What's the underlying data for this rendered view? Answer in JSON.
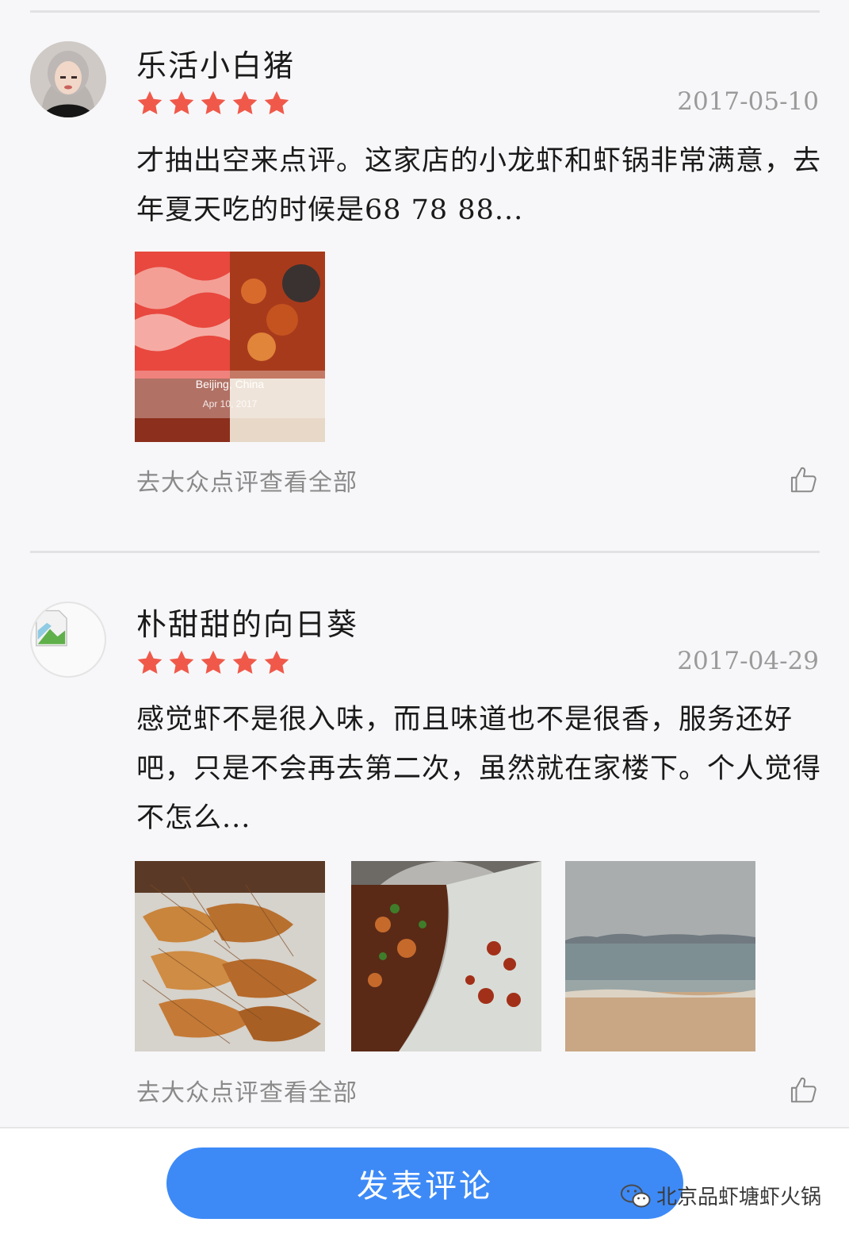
{
  "reviews": [
    {
      "username": "乐活小白猪",
      "rating": 5,
      "date": "2017-05-10",
      "text": "才抽出空来点评。这家店的小龙虾和虾锅非常满意，去年夏天吃的时候是68 78 88...",
      "photos": [
        {
          "name": "collage-photo",
          "overlay_place": "Beijing, China",
          "overlay_date": "Apr 10, 2017"
        }
      ],
      "more_link": "去大众点评查看全部"
    },
    {
      "username": "朴甜甜的向日葵",
      "rating": 5,
      "date": "2017-04-29",
      "text": "感觉虾不是很入味，而且味道也不是很香，服务还好吧，只是不会再去第二次，虽然就在家楼下。个人觉得不怎么...",
      "photos": [
        {
          "name": "fried-shrimp-photo"
        },
        {
          "name": "hotpot-photo"
        },
        {
          "name": "beach-photo"
        }
      ],
      "more_link": "去大众点评查看全部"
    }
  ],
  "bottom_bar": {
    "post_button": "发表评论",
    "watermark": "北京品虾塘虾火锅"
  },
  "colors": {
    "star": "#f0594a",
    "button": "#3d8af7",
    "date": "#9a9a9a",
    "link": "#8a8a8a"
  },
  "icons": [
    "star-icon",
    "thumbs-up-icon",
    "wechat-icon",
    "broken-image-icon"
  ]
}
